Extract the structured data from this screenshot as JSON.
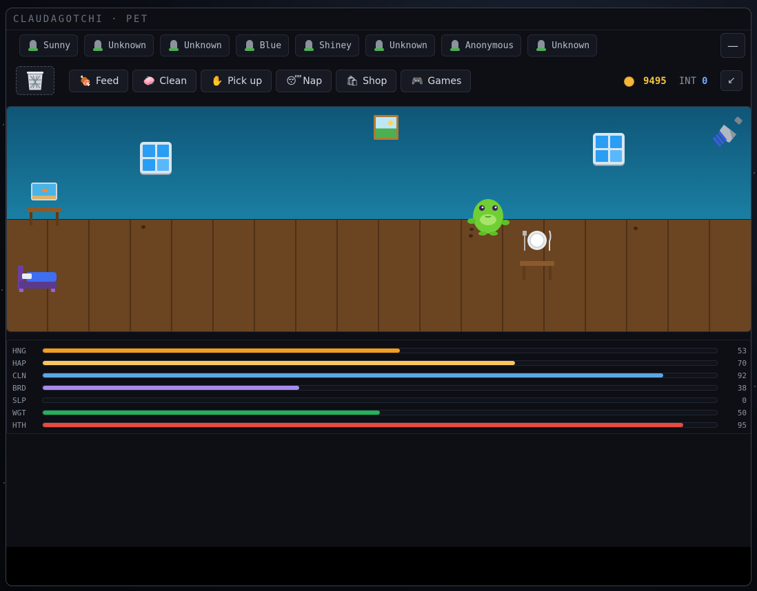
{
  "window": {
    "title": "CLAUDAGOTCHI · PET"
  },
  "pets": [
    {
      "name": "Sunny",
      "icon": "grave-icon"
    },
    {
      "name": "Unknown",
      "icon": "grave-icon"
    },
    {
      "name": "Unknown",
      "icon": "grave-icon"
    },
    {
      "name": "Blue",
      "icon": "grave-icon"
    },
    {
      "name": "Shiney",
      "icon": "grave-icon"
    },
    {
      "name": "Unknown",
      "icon": "grave-icon"
    },
    {
      "name": "Anonymous",
      "icon": "grave-icon"
    },
    {
      "name": "Unknown",
      "icon": "grave-icon"
    }
  ],
  "toolbar": {
    "minimize_label": "—",
    "collapse_label": "↙",
    "actions": [
      {
        "label": "Feed",
        "icon": "🍖"
      },
      {
        "label": "Clean",
        "icon": "🧼"
      },
      {
        "label": "Pick up",
        "icon": "✋"
      },
      {
        "label": "Nap",
        "icon": "😴"
      },
      {
        "label": "Shop",
        "icon": "🛍"
      },
      {
        "label": "Games",
        "icon": "🎮"
      }
    ]
  },
  "status": {
    "coins": "9495",
    "int_label": "INT",
    "int_value": "0"
  },
  "stats": [
    {
      "label": "HNG",
      "value": 53,
      "color": "#f59e1b"
    },
    {
      "label": "HAP",
      "value": 70,
      "color": "#fcc65a"
    },
    {
      "label": "CLN",
      "value": 92,
      "color": "#5aa7e6"
    },
    {
      "label": "BRD",
      "value": 38,
      "color": "#a88bf0"
    },
    {
      "label": "SLP",
      "value": 0,
      "color": "#60a5fa"
    },
    {
      "label": "WGT",
      "value": 50,
      "color": "#22b35a"
    },
    {
      "label": "HTH",
      "value": 95,
      "color": "#ea4a3c"
    }
  ],
  "colors": {
    "coin": "#f4c542",
    "int": "#6ea8ff",
    "wall": "#1a7fa3",
    "floor": "#6b4422"
  }
}
